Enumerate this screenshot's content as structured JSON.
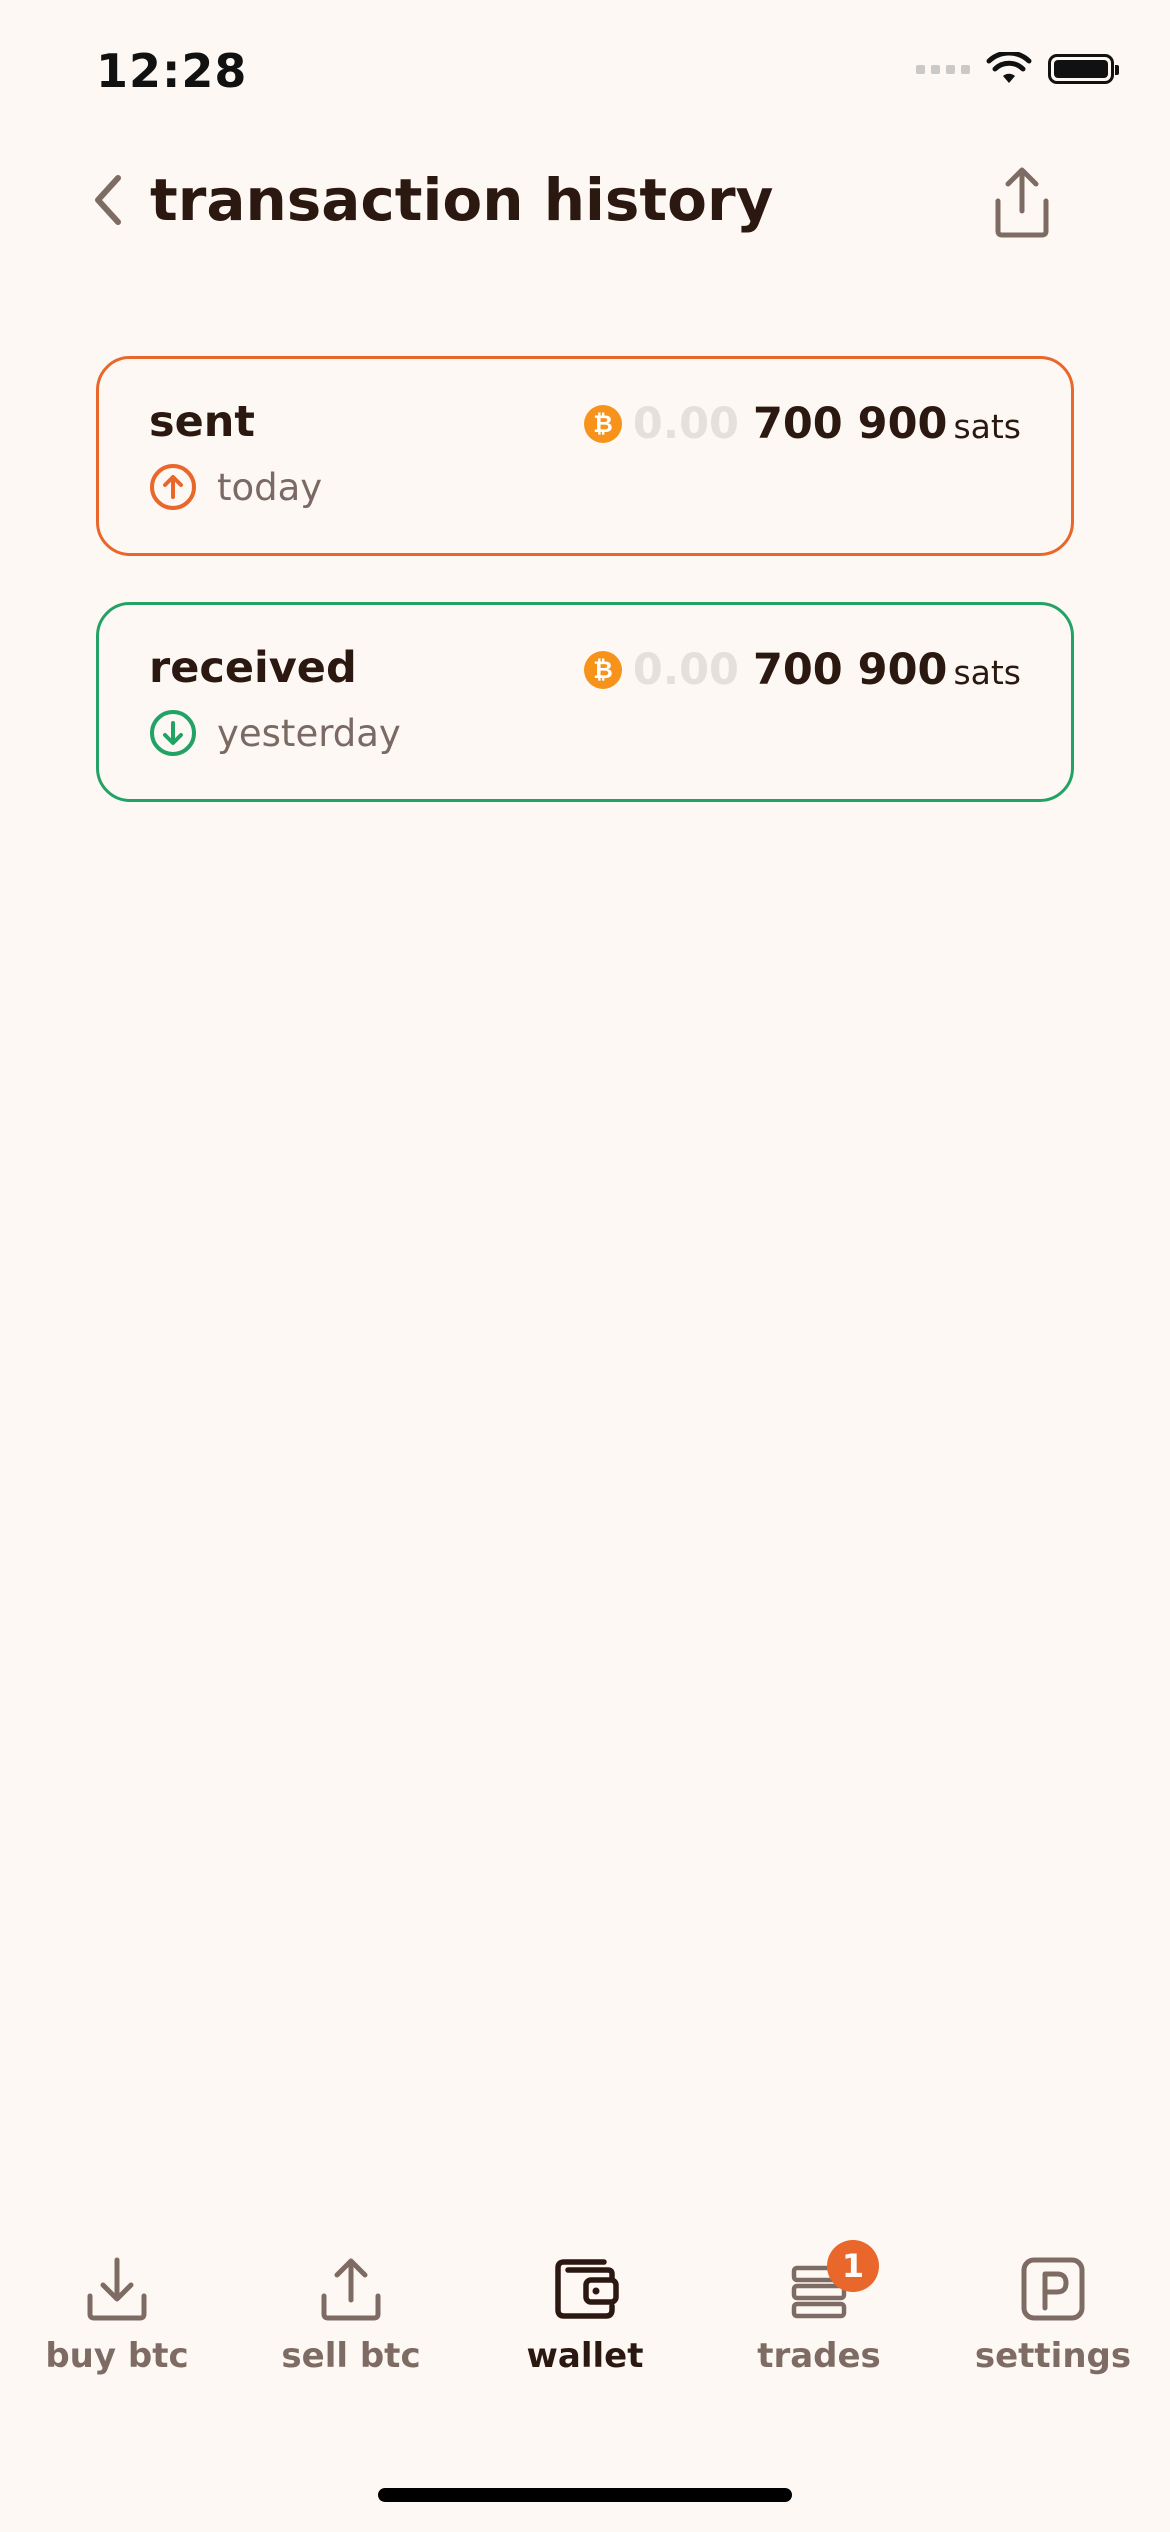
{
  "status_bar": {
    "time": "12:28"
  },
  "header": {
    "title": "transaction history"
  },
  "transactions": [
    {
      "type": "sent",
      "date": "today",
      "amount_zeros": "0.00",
      "amount": "700 900",
      "unit": "sats",
      "direction": "outgoing",
      "color": "#E9672B"
    },
    {
      "type": "received",
      "date": "yesterday",
      "amount_zeros": "0.00",
      "amount": "700 900",
      "unit": "sats",
      "direction": "incoming",
      "color": "#22A365"
    }
  ],
  "nav": {
    "items": [
      {
        "label": "buy btc",
        "icon": "download-icon"
      },
      {
        "label": "sell btc",
        "icon": "upload-icon"
      },
      {
        "label": "wallet",
        "icon": "wallet-icon",
        "active": true
      },
      {
        "label": "trades",
        "icon": "trades-icon",
        "badge": "1"
      },
      {
        "label": "settings",
        "icon": "settings-icon"
      }
    ]
  },
  "colors": {
    "background": "#FDF8F4",
    "accent": "#E9672B",
    "success": "#22A365",
    "bitcoin": "#F7931A",
    "text": "#2B1911",
    "muted": "#7A6A63"
  }
}
